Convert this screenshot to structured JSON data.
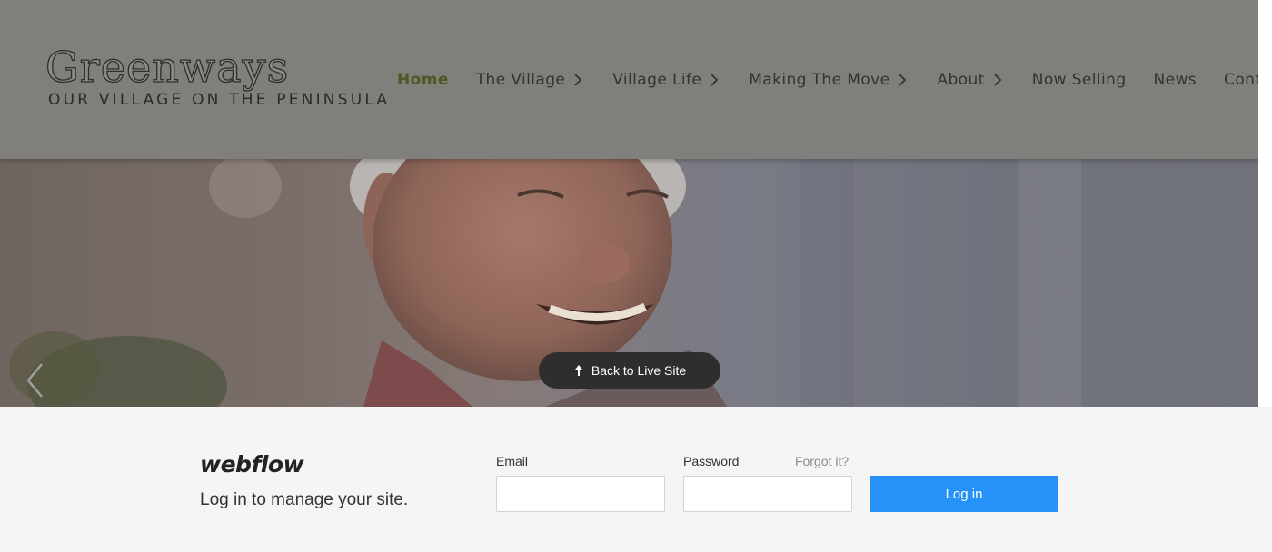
{
  "header": {
    "logo_word": "Greenways",
    "logo_tagline": "OUR VILLAGE ON THE PENINSULA",
    "nav": [
      {
        "label": "Home",
        "has_chevron": false,
        "active": true
      },
      {
        "label": "The Village",
        "has_chevron": true,
        "active": false
      },
      {
        "label": "Village Life",
        "has_chevron": true,
        "active": false
      },
      {
        "label": "Making The Move",
        "has_chevron": true,
        "active": false
      },
      {
        "label": "About",
        "has_chevron": true,
        "active": false
      },
      {
        "label": "Now Selling",
        "has_chevron": false,
        "active": false
      },
      {
        "label": "News",
        "has_chevron": false,
        "active": false
      },
      {
        "label": "Contact",
        "has_chevron": false,
        "active": false
      }
    ],
    "chevron_icon": "chevron-right-icon"
  },
  "hero": {
    "prev_icon": "chevron-left-icon",
    "back_to_live": {
      "label": "Back to Live Site",
      "icon": "arrow-up-icon"
    }
  },
  "login": {
    "brand": "webflow",
    "subtitle": "Log in to manage your site.",
    "email_label": "Email",
    "email_value": "",
    "password_label": "Password",
    "password_value": "",
    "forgot_label": "Forgot it?",
    "submit_label": "Log in"
  },
  "colors": {
    "accent_button": "#2692f7",
    "active_nav": "#4b5a22",
    "overlay_header": "#807f7b",
    "pill_bg": "#2e2e2e"
  }
}
